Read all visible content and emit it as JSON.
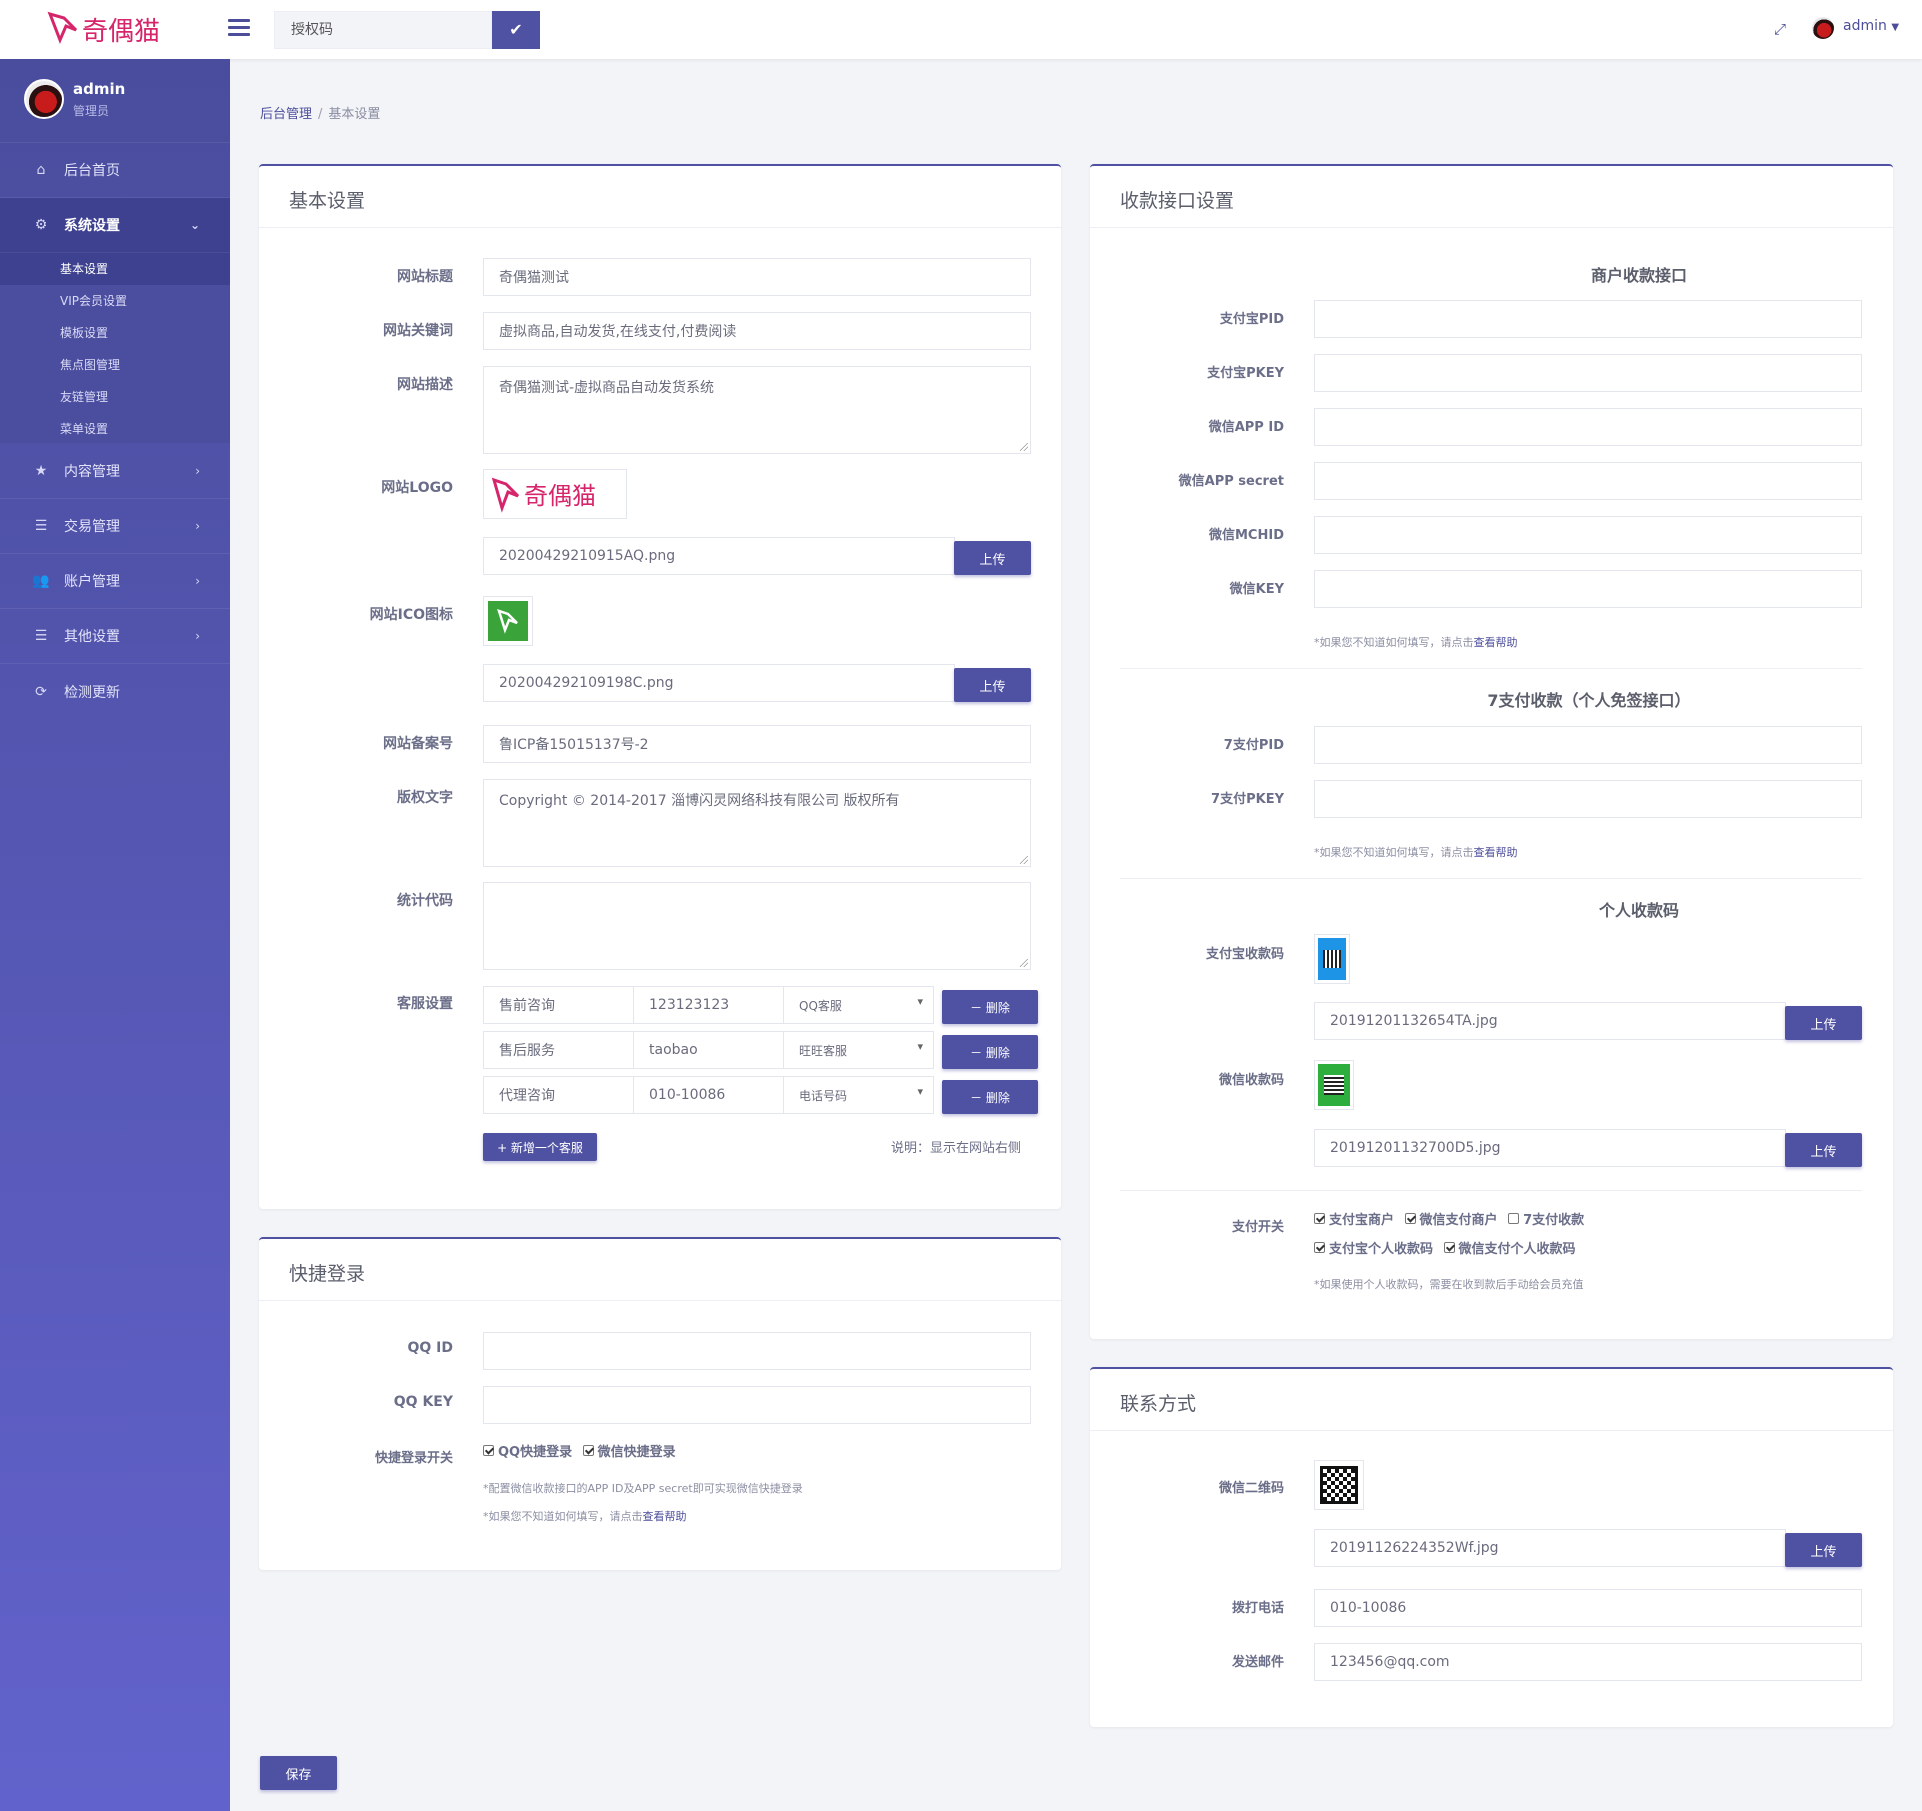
{
  "header": {
    "auth_placeholder": "授权码",
    "user": "admin"
  },
  "sidebar": {
    "user": "admin",
    "role": "管理员",
    "items": [
      {
        "label": "后台首页",
        "icon": "home-icon"
      },
      {
        "label": "系统设置",
        "icon": "gear-icon"
      },
      {
        "label": "内容管理",
        "icon": "star-icon"
      },
      {
        "label": "交易管理",
        "icon": "list-icon"
      },
      {
        "label": "账户管理",
        "icon": "users-icon"
      },
      {
        "label": "其他设置",
        "icon": "list-icon"
      },
      {
        "label": "检测更新",
        "icon": "refresh-icon"
      }
    ],
    "sub": [
      "基本设置",
      "VIP会员设置",
      "模板设置",
      "焦点图管理",
      "友链管理",
      "菜单设置"
    ]
  },
  "breadcrumb": {
    "root": "后台管理",
    "current": "基本设置"
  },
  "basic": {
    "title": "基本设置",
    "site_title_label": "网站标题",
    "site_title": "奇偶猫测试",
    "keywords_label": "网站关键词",
    "keywords": "虚拟商品,自动发货,在线支付,付费阅读",
    "desc_label": "网站描述",
    "desc": "奇偶猫测试-虚拟商品自动发货系统",
    "logo_label": "网站LOGO",
    "logo_file": "20200429210915AQ.png",
    "ico_label": "网站ICO图标",
    "ico_file": "202004292109198C.png",
    "icp_label": "网站备案号",
    "icp": "鲁ICP备15015137号-2",
    "copyright_label": "版权文字",
    "copyright": "Copyright © 2014-2017 淄博闪灵网络科技有限公司 版权所有",
    "stats_label": "统计代码",
    "stats": "",
    "service_label": "客服设置",
    "services": [
      {
        "name": "售前咨询",
        "value": "123123123",
        "type": "QQ客服"
      },
      {
        "name": "售后服务",
        "value": "taobao",
        "type": "旺旺客服"
      },
      {
        "name": "代理咨询",
        "value": "010-10086",
        "type": "电话号码"
      }
    ],
    "delete_label": "－ 删除",
    "add_service": "+ 新增一个客服",
    "service_note": "说明：显示在网站右侧",
    "upload": "上传"
  },
  "quick": {
    "title": "快捷登录",
    "qqid_label": "QQ ID",
    "qqid": "",
    "qqkey_label": "QQ KEY",
    "qqkey": "",
    "switch_label": "快捷登录开关",
    "qq_login": "QQ快捷登录",
    "wx_login": "微信快捷登录",
    "hint1": "*配置微信收款接口的APP ID及APP secret即可实现微信快捷登录",
    "hint2_pre": "*如果您不知道如何填写，请点击",
    "hint2_link": "查看帮助"
  },
  "payment": {
    "title": "收款接口设置",
    "merchant_title": "商户收款接口",
    "fields": [
      "支付宝PID",
      "支付宝PKEY",
      "微信APP ID",
      "微信APP secret",
      "微信MCHID",
      "微信KEY"
    ],
    "hint_pre": "*如果您不知道如何填写，请点击",
    "hint_link": "查看帮助",
    "seven_title": "7支付收款（个人免签接口）",
    "seven_fields": [
      "7支付PID",
      "7支付PKEY"
    ],
    "personal_title": "个人收款码",
    "alipay_qr_label": "支付宝收款码",
    "alipay_qr_file": "20191201132654TA.jpg",
    "wx_qr_label": "微信收款码",
    "wx_qr_file": "20191201132700D5.jpg",
    "switch_label": "支付开关",
    "switches": [
      {
        "label": "支付宝商户",
        "checked": true
      },
      {
        "label": "微信支付商户",
        "checked": true
      },
      {
        "label": "7支付收款",
        "checked": false
      },
      {
        "label": "支付宝个人收款码",
        "checked": true
      },
      {
        "label": "微信支付个人收款码",
        "checked": true
      }
    ],
    "switch_hint": "*如果使用个人收款码，需要在收到款后手动给会员充值",
    "upload": "上传"
  },
  "contact": {
    "title": "联系方式",
    "wx_label": "微信二维码",
    "wx_file": "20191126224352Wf.jpg",
    "phone_label": "拨打电话",
    "phone": "010-10086",
    "email_label": "发送邮件",
    "email": "123456@qq.com",
    "upload": "上传"
  },
  "save": "保存",
  "colors": {
    "primary": "#4f51a3",
    "sidebar_top": "#4a4d9d",
    "sidebar_bottom": "#6262cc",
    "logo": "#d6256b"
  }
}
